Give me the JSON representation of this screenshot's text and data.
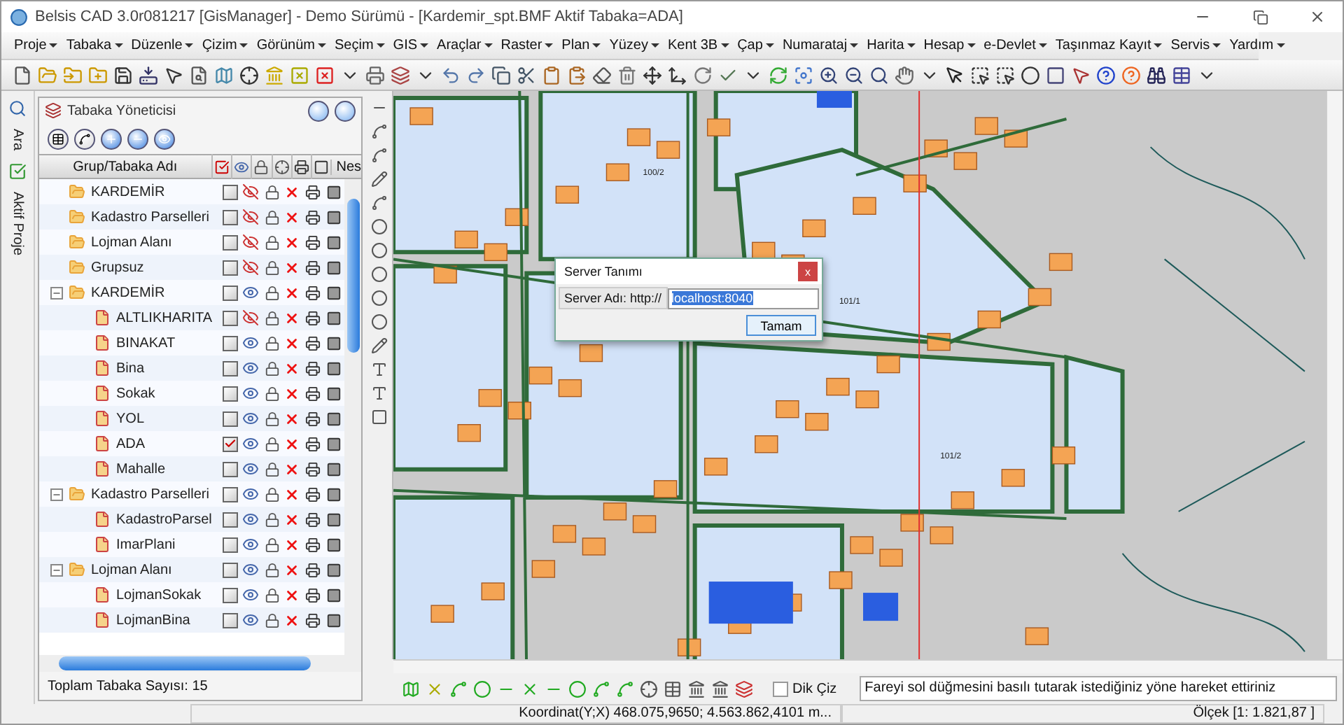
{
  "window": {
    "title": "Belsis CAD 3.0r081217 [GisManager] - Demo Sürümü - [Kardemir_spt.BMF  Aktif Tabaka=ADA]"
  },
  "menu": [
    "Proje",
    "Tabaka",
    "Düzenle",
    "Çizim",
    "Görünüm",
    "Seçim",
    "GIS",
    "Araçlar",
    "Raster",
    "Plan",
    "Yüzey",
    "Kent 3B",
    "Çap",
    "Numarataj",
    "Harita",
    "Hesap",
    "e-Devlet",
    "Taşınmaz Kayıt",
    "Servis",
    "Yardım"
  ],
  "side_tabs": [
    "Ara",
    "Aktif Proje"
  ],
  "layer_panel": {
    "title": "Tabaka Yöneticisi",
    "name_column": "Grup/Tabaka Adı",
    "last_column": "Nes",
    "total": "Toplam Tabaka Sayısı: 15",
    "layers": [
      {
        "name": "KARDEMİR",
        "kind": "group",
        "checked": false,
        "visible": false
      },
      {
        "name": "Kadastro Parselleri",
        "kind": "group",
        "checked": false,
        "visible": false
      },
      {
        "name": "Lojman Alanı",
        "kind": "group",
        "checked": false,
        "visible": false
      },
      {
        "name": "Grupsuz",
        "kind": "group",
        "checked": false,
        "visible": false
      },
      {
        "name": "KARDEMİR",
        "kind": "group",
        "checked": false,
        "visible": true,
        "children": [
          {
            "name": "ALTLIKHARITA",
            "kind": "layer",
            "checked": false,
            "visible": false
          },
          {
            "name": "BINAKAT",
            "kind": "layer",
            "checked": false,
            "visible": true
          },
          {
            "name": "Bina",
            "kind": "layer",
            "checked": false,
            "visible": true
          },
          {
            "name": "Sokak",
            "kind": "layer",
            "checked": false,
            "visible": true
          },
          {
            "name": "YOL",
            "kind": "layer",
            "checked": false,
            "visible": true
          },
          {
            "name": "ADA",
            "kind": "layer",
            "checked": true,
            "visible": true
          },
          {
            "name": "Mahalle",
            "kind": "layer",
            "checked": false,
            "visible": true
          }
        ]
      },
      {
        "name": "Kadastro Parselleri",
        "kind": "group",
        "checked": false,
        "visible": true,
        "children": [
          {
            "name": "KadastroParsel",
            "kind": "layer",
            "checked": false,
            "visible": true
          },
          {
            "name": "ImarPlani",
            "kind": "layer",
            "checked": false,
            "visible": true
          }
        ]
      },
      {
        "name": "Lojman Alanı",
        "kind": "group",
        "checked": false,
        "visible": true,
        "children": [
          {
            "name": "LojmanSokak",
            "kind": "layer",
            "checked": false,
            "visible": true
          },
          {
            "name": "LojmanBina",
            "kind": "layer",
            "checked": false,
            "visible": true
          }
        ]
      }
    ]
  },
  "map": {
    "parcel_labels": [
      "100/2",
      "101/1",
      "101/2"
    ]
  },
  "dialog": {
    "title": "Server Tanımı",
    "close": "x",
    "label": "Server Adı: http://",
    "value": "localhost:8040",
    "button": "Tamam"
  },
  "bottom_tools": {
    "checkbox": {
      "label": "Dik Çiz",
      "checked": false
    },
    "hint": "Fareyi sol düğmesini basılı tutarak istediğiniz yöne hareket ettiriniz"
  },
  "status_bar": {
    "coordinates": "Koordinat(Y;X)  468.075,9650; 4.563.862,4101 m...",
    "scale": "Ölçek [1: 1.821,87 ]"
  }
}
